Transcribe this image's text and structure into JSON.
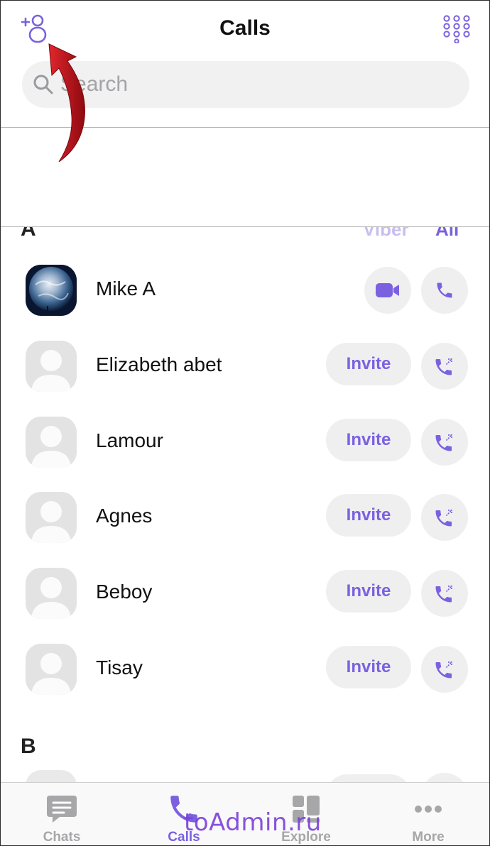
{
  "header": {
    "title": "Calls",
    "add_contact_icon": "add-contact-icon",
    "keypad_icon": "keypad-icon"
  },
  "search": {
    "placeholder": "Search",
    "icon": "search-icon"
  },
  "filters": {
    "section_letter": "A",
    "viber_label": "Viber",
    "all_label": "All"
  },
  "contacts": [
    {
      "name": "Mike A",
      "avatar": "earth-photo",
      "action_type": "video",
      "action_icon": "video-camera-icon",
      "call_icon": "phone-icon"
    },
    {
      "name": "Elizabeth abet",
      "avatar": "default-avatar",
      "action_type": "invite",
      "action_label": "Invite",
      "call_icon": "phone-outgoing-icon"
    },
    {
      "name": "Lamour",
      "avatar": "default-avatar",
      "action_type": "invite",
      "action_label": "Invite",
      "call_icon": "phone-outgoing-icon"
    },
    {
      "name": "Agnes",
      "avatar": "default-avatar",
      "action_type": "invite",
      "action_label": "Invite",
      "call_icon": "phone-outgoing-icon"
    },
    {
      "name": "Beboy",
      "avatar": "default-avatar",
      "action_type": "invite",
      "action_label": "Invite",
      "call_icon": "phone-outgoing-icon"
    },
    {
      "name": "Tisay",
      "avatar": "default-avatar",
      "action_type": "invite",
      "action_label": "Invite",
      "call_icon": "phone-outgoing-icon"
    }
  ],
  "section_b": "B",
  "tabs": [
    {
      "label": "Chats",
      "icon": "chat-bubble-icon",
      "active": false
    },
    {
      "label": "Calls",
      "icon": "phone-icon",
      "active": true
    },
    {
      "label": "Explore",
      "icon": "explore-grid-icon",
      "active": false
    },
    {
      "label": "More",
      "icon": "more-dots-icon",
      "active": false
    }
  ],
  "colors": {
    "accent": "#7b61e0",
    "inactive": "#a7a7aa",
    "pill_bg": "#efeff0",
    "annotation": "#c0111a"
  },
  "watermark": "toAdmin.ru"
}
